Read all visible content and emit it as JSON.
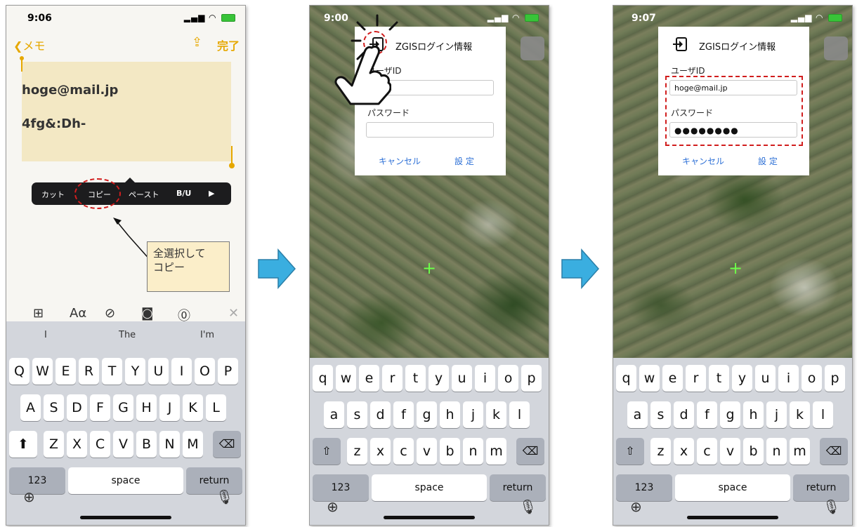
{
  "panel1": {
    "status_time": "9:06",
    "nav_back": "メモ",
    "nav_done": "完了",
    "note_lines": [
      "hoge@mail.jp",
      "4fg&:Dh-"
    ],
    "edit_menu": [
      "カット",
      "コピー",
      "ペースト",
      "B/U",
      "▶"
    ],
    "callout_text_1": "全選択して",
    "callout_text_2": "コピー",
    "toolbar_text": "Aα",
    "predictions": [
      "I",
      "The",
      "I'm"
    ],
    "keyboard_rows": [
      [
        "Q",
        "W",
        "E",
        "R",
        "T",
        "Y",
        "U",
        "I",
        "O",
        "P"
      ],
      [
        "A",
        "S",
        "D",
        "F",
        "G",
        "H",
        "J",
        "K",
        "L"
      ],
      [
        "Z",
        "X",
        "C",
        "V",
        "B",
        "N",
        "M"
      ]
    ],
    "key_123": "123",
    "key_space": "space",
    "key_return": "return"
  },
  "panel2": {
    "status_time": "9:00",
    "dialog_title": "ZGISログイン情報",
    "userid_label": "ユーザID",
    "password_label": "パスワード",
    "userid_value": "",
    "password_value": "",
    "cancel_label": "キャンセル",
    "ok_label": "設 定",
    "keyboard_rows": [
      [
        "q",
        "w",
        "e",
        "r",
        "t",
        "y",
        "u",
        "i",
        "o",
        "p"
      ],
      [
        "a",
        "s",
        "d",
        "f",
        "g",
        "h",
        "j",
        "k",
        "l"
      ],
      [
        "z",
        "x",
        "c",
        "v",
        "b",
        "n",
        "m"
      ]
    ],
    "key_123": "123",
    "key_space": "space",
    "key_return": "return"
  },
  "panel3": {
    "status_time": "9:07",
    "dialog_title": "ZGISログイン情報",
    "userid_label": "ユーザID",
    "password_label": "パスワード",
    "userid_value": "hoge@mail.jp",
    "password_value": "●●●●●●●●",
    "cancel_label": "キャンセル",
    "ok_label": "設 定",
    "keyboard_rows": [
      [
        "q",
        "w",
        "e",
        "r",
        "t",
        "y",
        "u",
        "i",
        "o",
        "p"
      ],
      [
        "a",
        "s",
        "d",
        "f",
        "g",
        "h",
        "j",
        "k",
        "l"
      ],
      [
        "z",
        "x",
        "c",
        "v",
        "b",
        "n",
        "m"
      ]
    ],
    "key_123": "123",
    "key_space": "space",
    "key_return": "return"
  },
  "colors": {
    "notes_accent": "#e6a800",
    "link_blue": "#2c6fd6",
    "highlight_red": "#d11e1e",
    "arrow_blue": "#3aaee0",
    "crosshair_green": "#6dff4a"
  },
  "icons": [
    "back-chevron-icon",
    "share-icon",
    "table-icon",
    "checklist-icon",
    "camera-icon",
    "markup-icon",
    "close-icon",
    "globe-icon",
    "microphone-icon",
    "shift-icon",
    "backspace-icon",
    "login-icon",
    "tap-hand-icon",
    "right-arrow-icon"
  ]
}
